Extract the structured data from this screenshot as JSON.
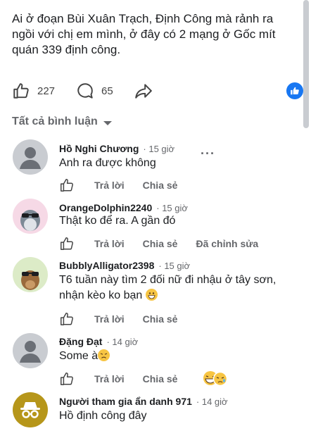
{
  "post": {
    "text": "Ai ở đoạn Bùi Xuân Trạch, Định Công mà rảnh ra ngồi với chị em mình, ở đây có 2 mạng ở Gốc mít quán 339 định công.",
    "like_count": "227",
    "comment_count": "65"
  },
  "filter": {
    "label": "Tất cả bình luận"
  },
  "comments": [
    {
      "name": "Hồ Nghi Chương",
      "time": "· 15 giờ",
      "text": "Anh ra được không",
      "reply": "Trả lời",
      "share": "Chia sẻ",
      "more": "···"
    },
    {
      "name": "OrangeDolphin2240",
      "time": "· 15 giờ",
      "text": "Thật ko để ra. A gần đó",
      "reply": "Trả lời",
      "share": "Chia sẻ",
      "edited": "Đã chỉnh sửa"
    },
    {
      "name": "BubblyAlligator2398",
      "time": "· 15 giờ",
      "text": "T6 tuần này tìm 2 đối nữ đi nhậu ở tây sơn, nhận kèo ko bạn",
      "reply": "Trả lời",
      "share": "Chia sẻ"
    },
    {
      "name": "Đặng Đạt",
      "time": "· 14 giờ",
      "text": "Some à",
      "reply": "Trả lời",
      "share": "Chia sẻ"
    },
    {
      "name": "Người tham gia ẩn danh 971",
      "time": "· 14 giờ",
      "text": "Hồ định công đây"
    }
  ],
  "colors": {
    "accent": "#1877f2",
    "muted": "#65676b",
    "text": "#1c1e21"
  }
}
